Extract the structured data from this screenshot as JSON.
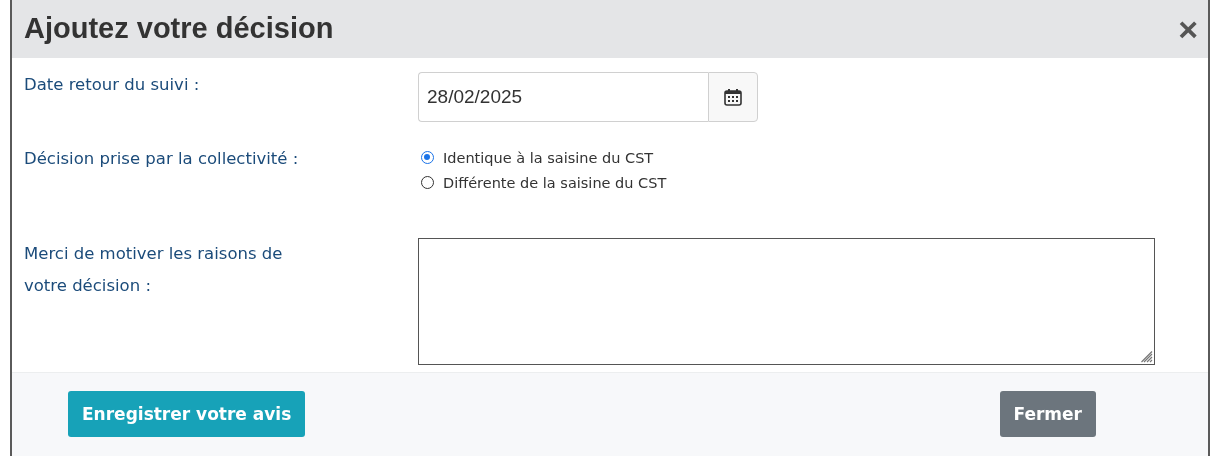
{
  "dialog": {
    "title": "Ajoutez votre décision",
    "close": "×"
  },
  "date_field": {
    "label": "Date retour du suivi :",
    "value": "28/02/2025"
  },
  "decision": {
    "label": "Décision prise par la collectivité :",
    "options": [
      {
        "label": "Identique à la saisine du CST",
        "selected": true
      },
      {
        "label": "Différente de la saisine du CST",
        "selected": false
      }
    ]
  },
  "reasons": {
    "label": "Merci de motiver les raisons de votre décision :"
  },
  "buttons": [
    {
      "label": "Enregistrer votre avis",
      "kind": "primary"
    },
    {
      "label": "Fermer",
      "kind": "secondary"
    }
  ]
}
